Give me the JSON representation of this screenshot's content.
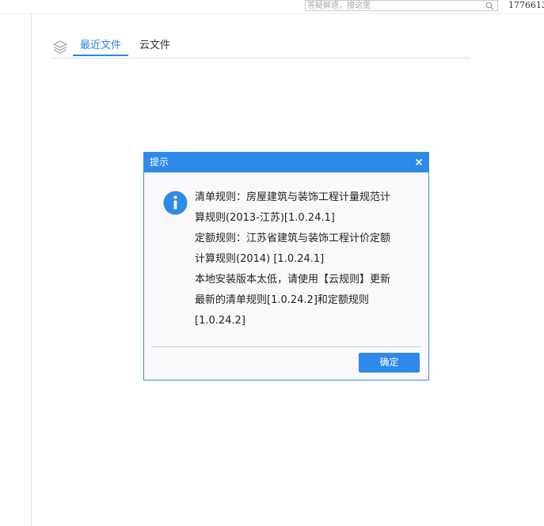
{
  "topbar": {
    "search": {
      "placeholder": "答疑解惑，搜这里"
    },
    "user_id": "1776613"
  },
  "tabs": [
    {
      "label": "最近文件",
      "active": true
    },
    {
      "label": "云文件",
      "active": false
    }
  ],
  "dialog": {
    "title": "提示",
    "close_glyph": "×",
    "message_lines": [
      "清单规则：房屋建筑与装饰工程计量规范计",
      "算规则(2013-江苏)[1.0.24.1]",
      "定额规则：江苏省建筑与装饰工程计价定额",
      "计算规则(2014) [1.0.24.1]",
      "本地安装版本太低，请使用【云规则】更新",
      "最新的清单规则[1.0.24.2]和定额规则",
      "[1.0.24.2]"
    ],
    "ok_label": "确定"
  },
  "colors": {
    "accent": "#2d8ae8",
    "tab_active": "#2a86e0",
    "dialog_bg": "#faf8fa"
  },
  "icons": {
    "search": "search-icon",
    "layers": "layers-icon",
    "close": "close-icon",
    "info": "info-icon"
  }
}
